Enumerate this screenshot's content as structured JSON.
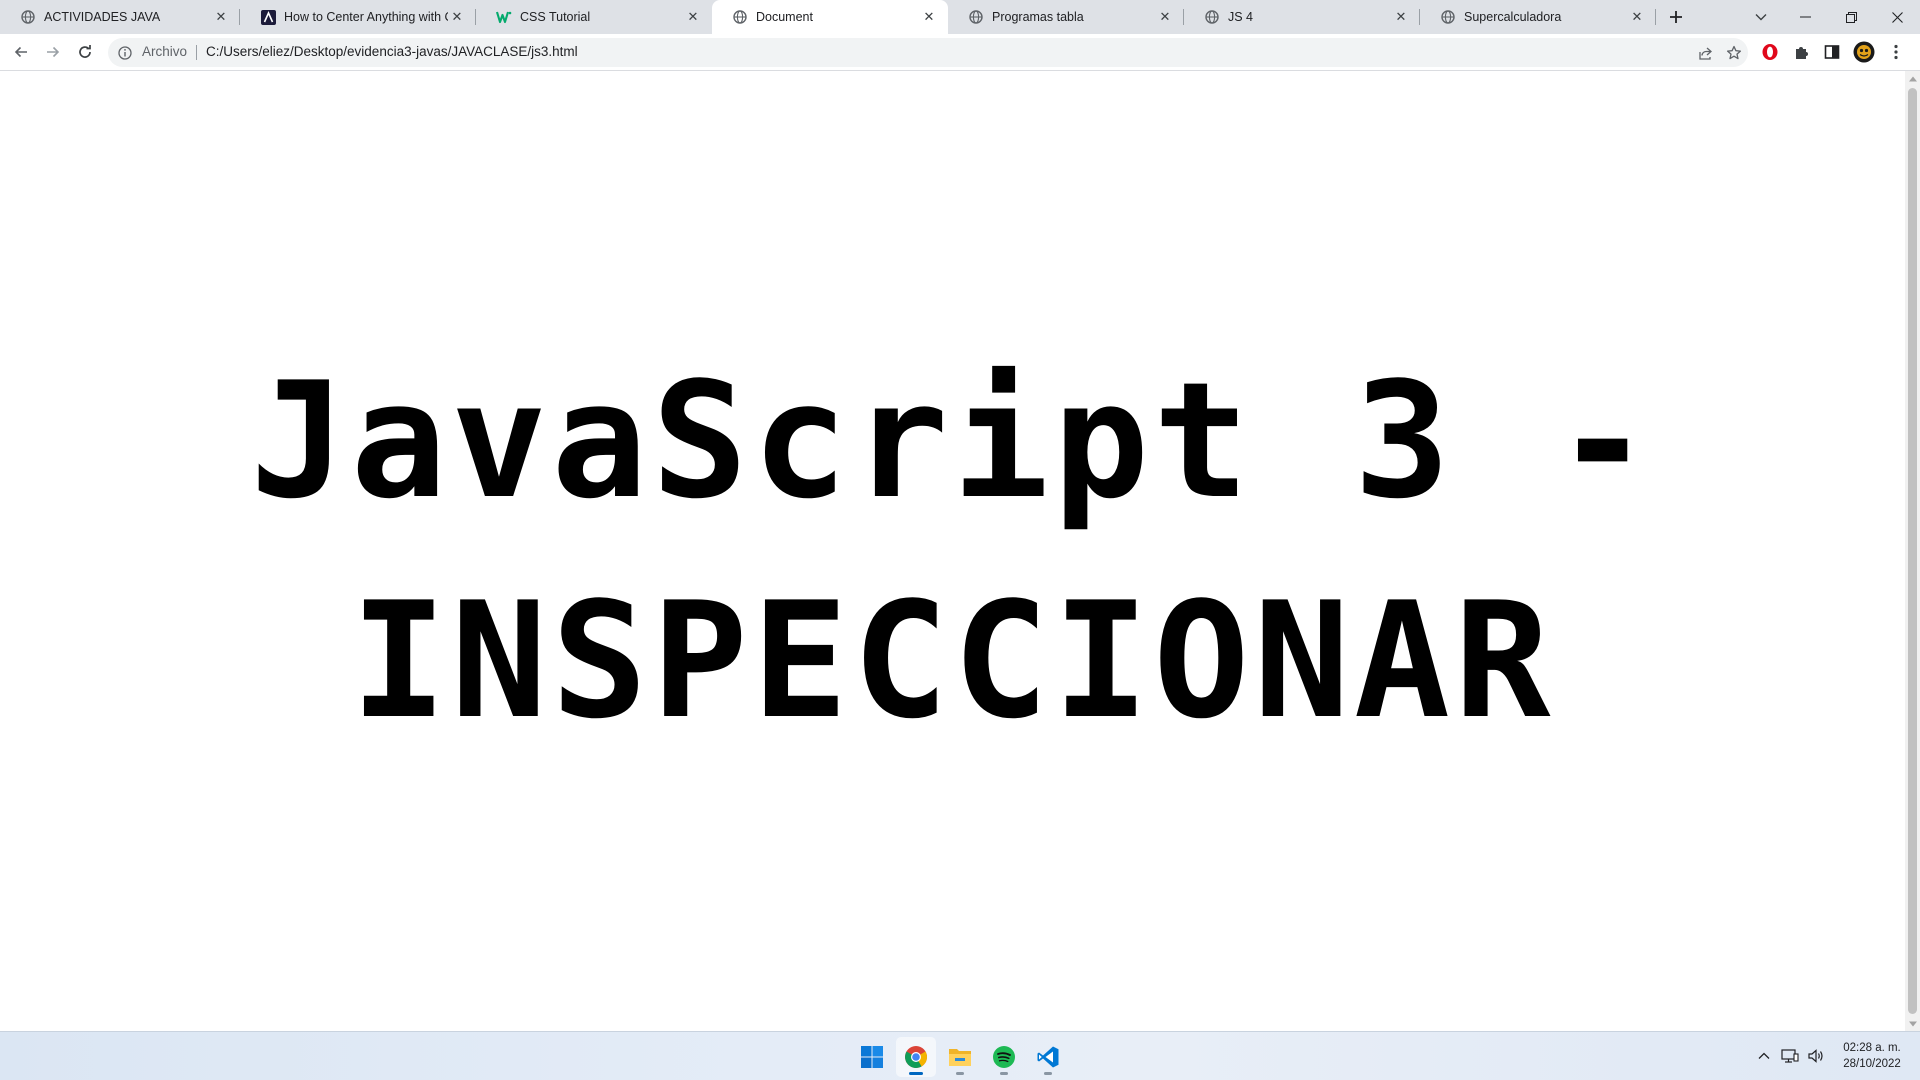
{
  "browser": {
    "tabs": [
      {
        "title": "ACTIVIDADES JAVA",
        "favicon": "globe-icon",
        "active": false
      },
      {
        "title": "How to Center Anything with CSS",
        "favicon": "a-logo-icon",
        "active": false
      },
      {
        "title": "CSS Tutorial",
        "favicon": "w3schools-icon",
        "active": false
      },
      {
        "title": "Document",
        "favicon": "globe-icon",
        "active": true
      },
      {
        "title": "Programas tabla",
        "favicon": "globe-icon",
        "active": false
      },
      {
        "title": "JS 4",
        "favicon": "globe-icon",
        "active": false
      },
      {
        "title": "Supercalculadora",
        "favicon": "globe-icon",
        "active": false
      }
    ],
    "address_bar": {
      "scheme_label": "Archivo",
      "url": "C:/Users/eliez/Desktop/evidencia3-javas/JAVACLASE/js3.html"
    }
  },
  "page": {
    "heading": "JavaScript 3 - INSPECCIONAR"
  },
  "taskbar": {
    "apps": [
      "start-icon",
      "chrome-icon",
      "file-explorer-icon",
      "spotify-icon",
      "vscode-icon"
    ],
    "active_app": "chrome-icon",
    "clock": {
      "time": "02:28 a. m.",
      "date": "28/10/2022"
    }
  },
  "colors": {
    "tabstrip_bg": "#dee1e6",
    "page_bg": "#ffffff",
    "heading_text": "#000000",
    "opera_red": "#e0081b",
    "vscode_blue": "#0078d4",
    "spotify_green": "#1db954"
  }
}
